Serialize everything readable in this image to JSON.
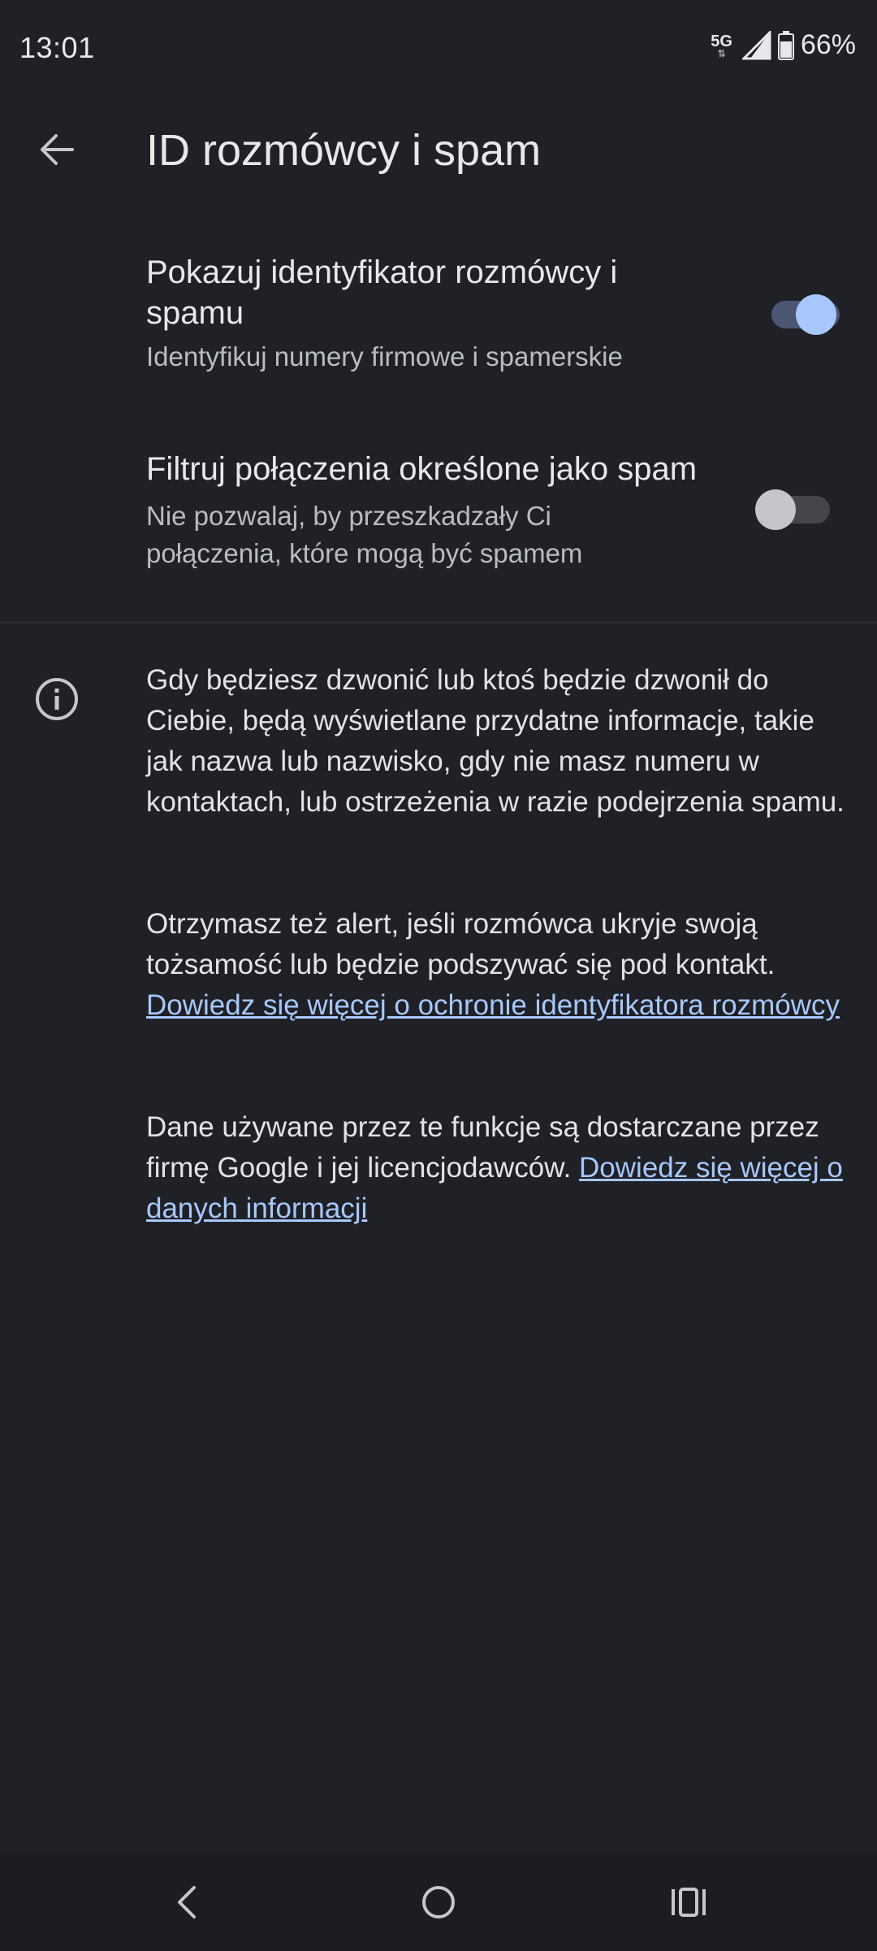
{
  "status": {
    "time": "13:01",
    "network": "5G",
    "battery": "66%"
  },
  "header": {
    "title": "ID rozmówcy i spam"
  },
  "settings": [
    {
      "title": "Pokazuj identyfikator rozmówcy i spamu",
      "subtitle": "Identyfikuj numery firmowe i spamerskie",
      "enabled": true
    },
    {
      "title": "Filtruj połączenia określone jako spam",
      "subtitle": "Nie pozwalaj, by przeszkadzały Ci połączenia, które mogą być spamem",
      "enabled": false
    }
  ],
  "info": {
    "paragraph1": "Gdy będziesz dzwonić lub ktoś będzie dzwonił do Ciebie, będą wyświetlane przydatne informacje, takie jak nazwa lub nazwisko, gdy nie masz numeru w kontaktach, lub ostrzeżenia w razie podejrzenia spamu.",
    "paragraph2": "Otrzymasz też alert, jeśli rozmówca ukryje swoją tożsamość lub będzie podszywać się pod kontakt.",
    "link1": "Dowiedz się więcej o ochronie identyfikatora rozmówcy",
    "paragraph3": "Dane używane przez te funkcje są dostarczane przez firmę Google i jej licencjodawców.",
    "link2": "Dowiedz się więcej o danych informacji"
  },
  "colors": {
    "background": "#1f2126",
    "toggle_on_track": "#4a5672",
    "toggle_on_thumb": "#a8c7fa",
    "toggle_off_track": "#44464c",
    "toggle_off_thumb": "#c4c6cc",
    "link": "#a8c7fa"
  },
  "icons": {
    "back": "arrow-left-icon",
    "info": "info-icon",
    "nav_back": "chevron-left-icon",
    "nav_home": "circle-home-icon",
    "nav_recents": "recents-icon"
  }
}
